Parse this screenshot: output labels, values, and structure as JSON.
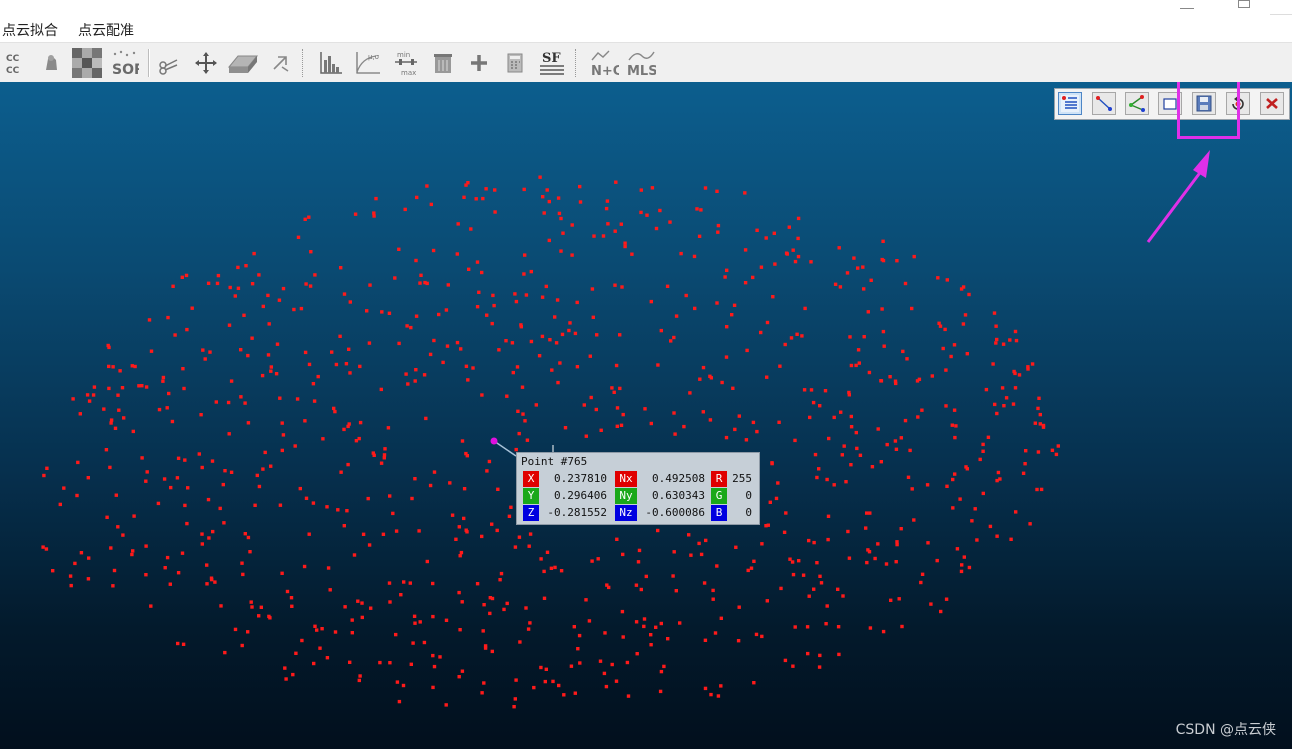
{
  "menu": {
    "item1": "点云拟合",
    "item2": "点云配准"
  },
  "toolbar": {
    "buttons": [
      {
        "icon": "cc-compare-icon",
        "text": "CC\nCC"
      },
      {
        "icon": "statue-icon"
      },
      {
        "icon": "checker-icon"
      },
      {
        "icon": "sor-filter-icon",
        "text": "SOR"
      },
      {
        "icon": "scissors-icon"
      },
      {
        "icon": "translate-rotate-icon"
      },
      {
        "icon": "plane-icon"
      },
      {
        "icon": "pick-rotation-center-icon"
      },
      {
        "icon": "histogram-icon"
      },
      {
        "icon": "scalar-field-gradient-icon",
        "text": "μ,σ"
      },
      {
        "icon": "filter-min-max-icon",
        "text": "min/max"
      },
      {
        "icon": "delete-scalar-field-icon"
      },
      {
        "icon": "add-icon"
      },
      {
        "icon": "calculator-icon"
      },
      {
        "icon": "sf-icon",
        "text": "SF"
      },
      {
        "icon": "normal-color-icon",
        "text": "N+C"
      },
      {
        "icon": "mls-icon",
        "text": "MLS"
      }
    ]
  },
  "overlay_toolbar": {
    "buttons": [
      {
        "icon": "point-list-icon",
        "active": true
      },
      {
        "icon": "two-points-distance-icon"
      },
      {
        "icon": "three-points-angle-icon"
      },
      {
        "icon": "rectangle-2d-label-icon"
      },
      {
        "icon": "save-icon"
      },
      {
        "icon": "reset-icon"
      },
      {
        "icon": "close-icon"
      }
    ]
  },
  "point_label": {
    "title": "Point #765",
    "rows": [
      {
        "c1": "X",
        "v1": "0.237810",
        "c2": "Nx",
        "v2": "0.492508",
        "c3": "R",
        "v3": "255"
      },
      {
        "c1": "Y",
        "v1": "0.296406",
        "c2": "Ny",
        "v2": "0.630343",
        "c3": "G",
        "v3": "0"
      },
      {
        "c1": "Z",
        "v1": "-0.281552",
        "c2": "Nz",
        "v2": "-0.600086",
        "c3": "B",
        "v3": "0"
      }
    ]
  },
  "colors": {
    "point": "#ff1a1a",
    "picked_point": "#e010e0",
    "annotation": "#e030e8",
    "chip_red": "#e00000",
    "chip_green": "#1aa81a",
    "chip_blue": "#0000e0"
  },
  "watermark": "CSDN @点云侠"
}
